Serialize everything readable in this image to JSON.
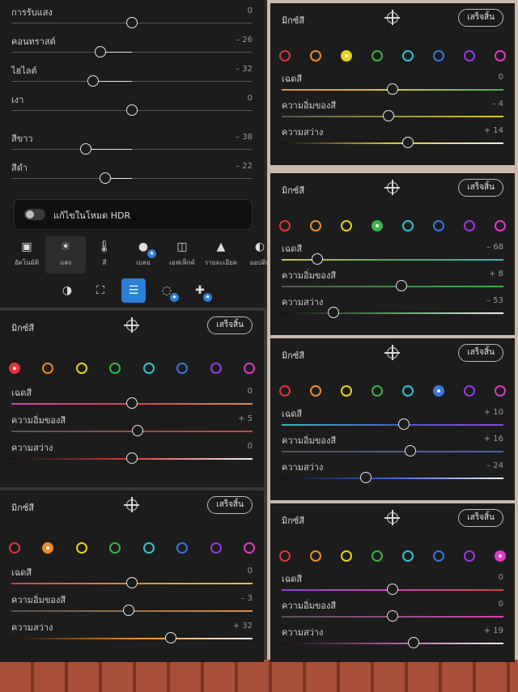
{
  "light_panel": {
    "sliders": [
      {
        "label": "การรับแสง",
        "value": "0",
        "pos": 0.5
      },
      {
        "label": "คอนทราสต์",
        "value": "– 26",
        "pos": 0.37
      },
      {
        "label": "ไฮไลต์",
        "value": "– 32",
        "pos": 0.34
      },
      {
        "label": "เงา",
        "value": "0",
        "pos": 0.5
      },
      {
        "label": "สีขาว",
        "value": "– 38",
        "pos": 0.31
      },
      {
        "label": "สีดำ",
        "value": "– 22",
        "pos": 0.39
      }
    ],
    "hdr_toggle_label": "แก้ไขในโหมด HDR",
    "tools": [
      {
        "label": "อัตโนมัติ",
        "icon": "auto-image-icon"
      },
      {
        "label": "แสง",
        "icon": "sun-icon"
      },
      {
        "label": "สี",
        "icon": "thermometer-icon"
      },
      {
        "label": "เบลอ",
        "icon": "drop-icon"
      },
      {
        "label": "เอฟเฟ็กต์",
        "icon": "effects-icon"
      },
      {
        "label": "รายละเอียด",
        "icon": "triangle-icon"
      },
      {
        "label": "ออปติก",
        "icon": "lens-icon"
      }
    ],
    "tabs": [
      {
        "icon": "presets-icon"
      },
      {
        "icon": "crop-icon"
      },
      {
        "icon": "sliders-icon"
      },
      {
        "icon": "masking-icon"
      },
      {
        "icon": "healing-icon"
      }
    ]
  },
  "color_mix_panels": [
    {
      "title": "มิกซ์สี",
      "done": "เสร็จสิ้น",
      "selected": 0,
      "sliders": [
        {
          "label": "เฉดสี",
          "value": "0",
          "pos": 0.5
        },
        {
          "label": "ความอิ่มของสี",
          "value": "+ 5",
          "pos": 0.525
        },
        {
          "label": "ความสว่าง",
          "value": "0",
          "pos": 0.5
        }
      ]
    },
    {
      "title": "มิกซ์สี",
      "done": "เสร็จสิ้น",
      "selected": 1,
      "sliders": [
        {
          "label": "เฉดสี",
          "value": "0",
          "pos": 0.5
        },
        {
          "label": "ความอิ่มของสี",
          "value": "– 3",
          "pos": 0.485
        },
        {
          "label": "ความสว่าง",
          "value": "+ 32",
          "pos": 0.66
        }
      ]
    },
    {
      "title": "มิกซ์สี",
      "done": "เสร็จสิ้น",
      "selected": 2,
      "sliders": [
        {
          "label": "เฉดสี",
          "value": "0",
          "pos": 0.5
        },
        {
          "label": "ความอิ่มของสี",
          "value": "– 4",
          "pos": 0.48
        },
        {
          "label": "ความสว่าง",
          "value": "+ 14",
          "pos": 0.57
        }
      ]
    },
    {
      "title": "มิกซ์สี",
      "done": "เสร็จสิ้น",
      "selected": 3,
      "sliders": [
        {
          "label": "เฉดสี",
          "value": "– 68",
          "pos": 0.16
        },
        {
          "label": "ความอิ่มของสี",
          "value": "+ 8",
          "pos": 0.54
        },
        {
          "label": "ความสว่าง",
          "value": "– 53",
          "pos": 0.235
        }
      ]
    },
    {
      "title": "มิกซ์สี",
      "done": "เสร็จสิ้น",
      "selected": 5,
      "sliders": [
        {
          "label": "เฉดสี",
          "value": "+ 10",
          "pos": 0.55
        },
        {
          "label": "ความอิ่มของสี",
          "value": "+ 16",
          "pos": 0.58
        },
        {
          "label": "ความสว่าง",
          "value": "– 24",
          "pos": 0.38
        }
      ]
    },
    {
      "title": "มิกซ์สี",
      "done": "เสร็จสิ้น",
      "selected": 7,
      "sliders": [
        {
          "label": "เฉดสี",
          "value": "0",
          "pos": 0.5
        },
        {
          "label": "ความอิ่มของสี",
          "value": "0",
          "pos": 0.5
        },
        {
          "label": "ความสว่าง",
          "value": "+ 19",
          "pos": 0.595
        }
      ]
    }
  ],
  "swatch_colors": [
    "#e3343a",
    "#f08a2a",
    "#e9d21e",
    "#3cb54a",
    "#33c2d0",
    "#3a78e0",
    "#9a3ae0",
    "#e03ac8"
  ],
  "track_colors": {
    "hue": [
      "#d84040",
      "#e88a30",
      "#d8c830",
      "#40b050",
      "#30b8c8",
      "#4060d8",
      "#9040d8",
      "#d840b8"
    ],
    "sat_from": "#555555"
  }
}
